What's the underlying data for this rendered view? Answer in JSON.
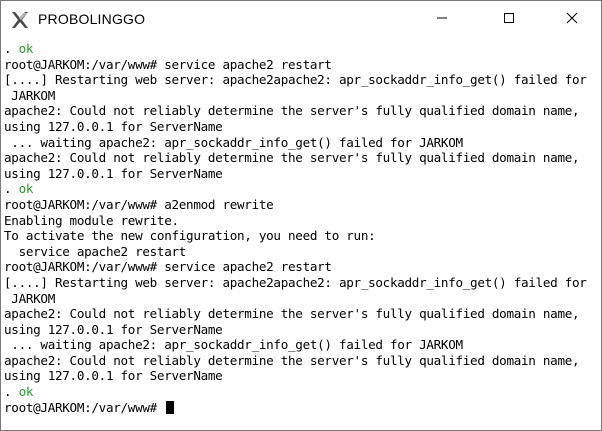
{
  "window": {
    "title": "PROBOLINGGO",
    "icon": "putty-x-icon",
    "controls": [
      "minimize-icon",
      "maximize-icon",
      "close-icon"
    ]
  },
  "terminal": {
    "ok_color": "#24a024",
    "lines": [
      {
        "prefix": ". ",
        "ok": "ok",
        "text": ""
      },
      {
        "text": "root@JARKOM:/var/www# service apache2 restart"
      },
      {
        "text": "[....] Restarting web server: apache2apache2: apr_sockaddr_info_get() failed for"
      },
      {
        "text": " JARKOM"
      },
      {
        "text": "apache2: Could not reliably determine the server's fully qualified domain name,"
      },
      {
        "text": "using 127.0.0.1 for ServerName"
      },
      {
        "text": " ... waiting apache2: apr_sockaddr_info_get() failed for JARKOM"
      },
      {
        "text": "apache2: Could not reliably determine the server's fully qualified domain name,"
      },
      {
        "text": "using 127.0.0.1 for ServerName"
      },
      {
        "prefix": ". ",
        "ok": "ok",
        "text": ""
      },
      {
        "text": "root@JARKOM:/var/www# a2enmod rewrite"
      },
      {
        "text": "Enabling module rewrite."
      },
      {
        "text": "To activate the new configuration, you need to run:"
      },
      {
        "text": "  service apache2 restart"
      },
      {
        "text": "root@JARKOM:/var/www# service apache2 restart"
      },
      {
        "text": "[....] Restarting web server: apache2apache2: apr_sockaddr_info_get() failed for"
      },
      {
        "text": " JARKOM"
      },
      {
        "text": "apache2: Could not reliably determine the server's fully qualified domain name,"
      },
      {
        "text": "using 127.0.0.1 for ServerName"
      },
      {
        "text": " ... waiting apache2: apr_sockaddr_info_get() failed for JARKOM"
      },
      {
        "text": "apache2: Could not reliably determine the server's fully qualified domain name,"
      },
      {
        "text": "using 127.0.0.1 for ServerName"
      },
      {
        "prefix": ". ",
        "ok": "ok",
        "text": ""
      },
      {
        "text": "root@JARKOM:/var/www# ",
        "cursor": true
      }
    ]
  }
}
